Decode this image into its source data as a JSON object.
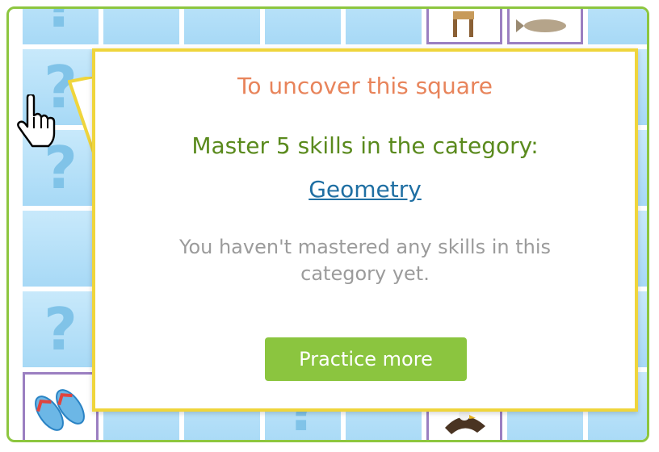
{
  "popup": {
    "title": "To uncover this square",
    "heading": "Master 5 skills in the category:",
    "category_link": "Geometry",
    "message": "You haven't mastered any skills in this category yet.",
    "button_label": "Practice more"
  },
  "board": {
    "hidden_square_symbol": "?",
    "revealed_prizes": [
      "giraffe-prize",
      "fish-prize",
      "flip-flops-prize",
      "eagle-prize"
    ]
  },
  "colors": {
    "board_border": "#8dc63f",
    "popup_border": "#efd53c",
    "title": "#e8845b",
    "heading": "#5a8a1d",
    "link": "#1f6fa3",
    "message": "#9b9b9b",
    "button": "#8bc53f",
    "revealed_square_frame": "#9b7fc1"
  }
}
